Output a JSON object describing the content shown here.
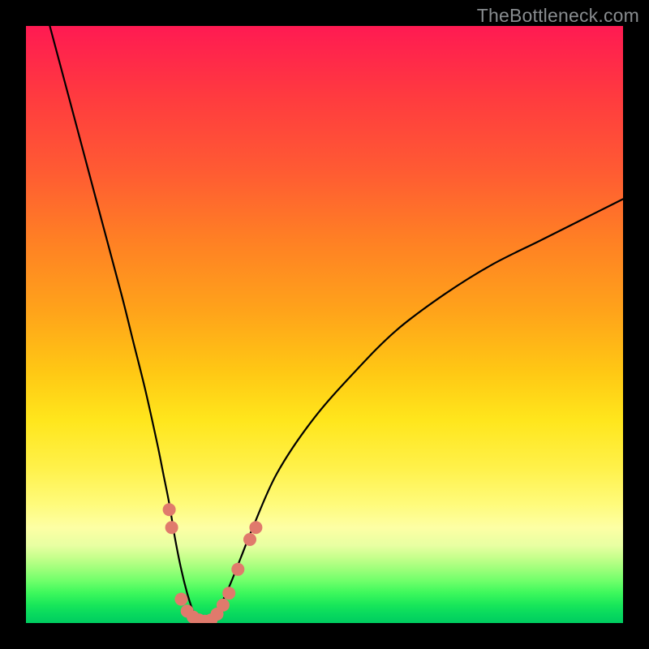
{
  "watermark": "TheBottleneck.com",
  "colors": {
    "frame": "#000000",
    "watermark_text": "#888c8f",
    "curve_stroke": "#000000",
    "marker_fill": "#e07a6c",
    "gradient_top": "#ff1a52",
    "gradient_bottom": "#00cc60"
  },
  "chart_data": {
    "type": "line",
    "title": "",
    "xlabel": "",
    "ylabel": "",
    "xlim": [
      0,
      100
    ],
    "ylim": [
      0,
      100
    ],
    "notes": "Two black curves on a vertical red→green gradient background. Left curve is a steep descending arc from top-left down to a valley near x≈26–33 (y≈0). Right curve rises from the same valley up to the right edge around y≈70. Salmon-colored marker dots cluster around the valley on both sides.",
    "series": [
      {
        "name": "left-curve",
        "x": [
          4,
          8,
          12,
          16,
          18,
          20,
          22,
          23,
          24,
          25,
          26,
          27,
          28,
          29,
          30
        ],
        "y": [
          100,
          85,
          70,
          55,
          47,
          39,
          30,
          25,
          20,
          14,
          9,
          5,
          2,
          0.5,
          0
        ]
      },
      {
        "name": "right-curve",
        "x": [
          30,
          32,
          34,
          36,
          38,
          42,
          48,
          55,
          62,
          70,
          78,
          86,
          94,
          100
        ],
        "y": [
          0,
          2,
          6,
          11,
          16,
          25,
          34,
          42,
          49,
          55,
          60,
          64,
          68,
          71
        ]
      }
    ],
    "markers": [
      {
        "x": 24.0,
        "y": 19
      },
      {
        "x": 24.4,
        "y": 16
      },
      {
        "x": 26.0,
        "y": 4
      },
      {
        "x": 27.0,
        "y": 2
      },
      {
        "x": 28.0,
        "y": 1
      },
      {
        "x": 29.0,
        "y": 0.5
      },
      {
        "x": 30.0,
        "y": 0.3
      },
      {
        "x": 31.0,
        "y": 0.5
      },
      {
        "x": 32.0,
        "y": 1.5
      },
      {
        "x": 33.0,
        "y": 3
      },
      {
        "x": 34.0,
        "y": 5
      },
      {
        "x": 35.5,
        "y": 9
      },
      {
        "x": 37.5,
        "y": 14
      },
      {
        "x": 38.5,
        "y": 16
      }
    ]
  }
}
